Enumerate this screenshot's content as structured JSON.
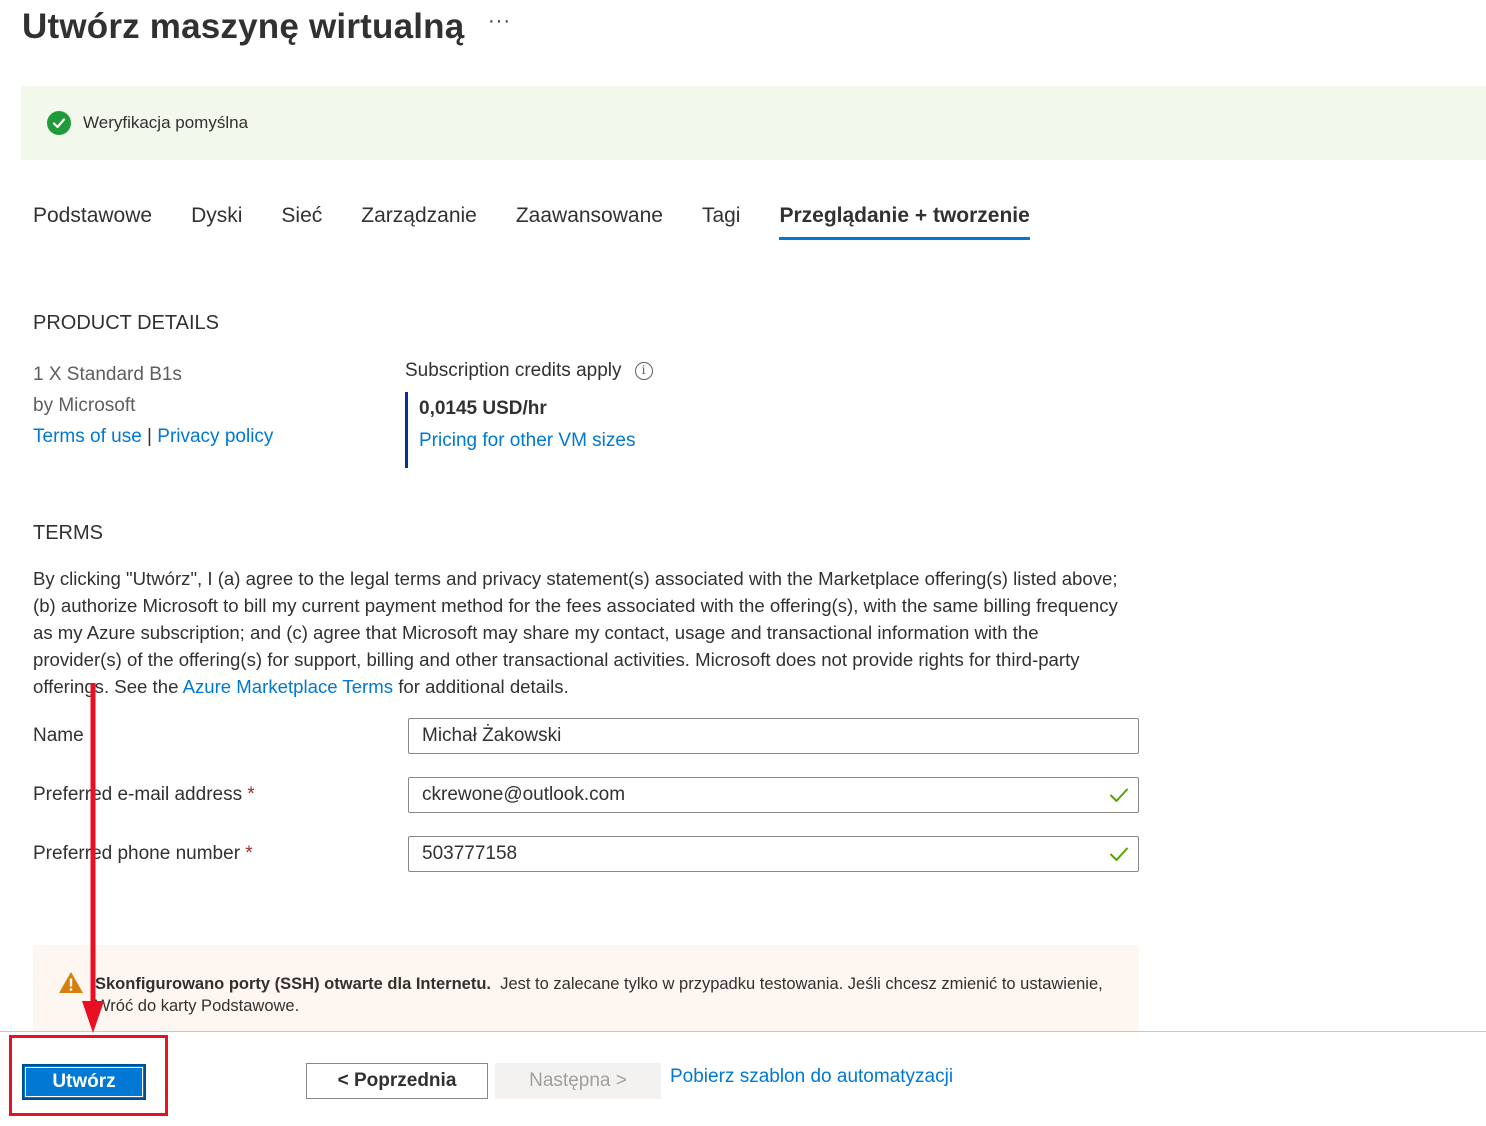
{
  "header": {
    "title": "Utwórz maszynę wirtualną",
    "more_label": "···"
  },
  "banner": {
    "message": "Weryfikacja pomyślna"
  },
  "tabs": [
    {
      "label": "Podstawowe"
    },
    {
      "label": "Dyski"
    },
    {
      "label": "Sieć"
    },
    {
      "label": "Zarządzanie"
    },
    {
      "label": "Zaawansowane"
    },
    {
      "label": "Tagi"
    },
    {
      "label": "Przeglądanie + tworzenie",
      "active": true
    }
  ],
  "product": {
    "heading": "PRODUCT DETAILS",
    "name": "1 X Standard B1s",
    "publisher": "by Microsoft",
    "terms_link": "Terms of use",
    "separator": "|",
    "privacy_link": "Privacy policy",
    "credits_label": "Subscription credits apply",
    "price": "0,0145 USD/hr",
    "pricing_link": "Pricing for other VM sizes"
  },
  "terms": {
    "heading": "TERMS",
    "text_before": "By clicking \"Utwórz\", I (a) agree to the legal terms and privacy statement(s) associated with the Marketplace offering(s) listed above; (b) authorize Microsoft to bill my current payment method for the fees associated with the offering(s), with the same billing frequency as my Azure subscription; and (c) agree that Microsoft may share my contact, usage and transactional information with the provider(s) of the offering(s) for support, billing and other transactional activities. Microsoft does not provide rights for third-party offerings. See the ",
    "link": "Azure Marketplace Terms",
    "text_after": " for additional details."
  },
  "form": {
    "name_label": "Name",
    "name_value": "Michał Żakowski",
    "email_label": "Preferred e-mail address",
    "email_value": "ckrewone@outlook.com",
    "phone_label": "Preferred phone number",
    "phone_value": "503777158",
    "required_mark": "*"
  },
  "warning": {
    "bold": "Skonfigurowano porty (SSH) otwarte dla Internetu.",
    "text": "Jest to zalecane tylko w przypadku testowania.  Jeśli chcesz zmienić to ustawienie, Wróć do karty Podstawowe."
  },
  "footer": {
    "create_label": "Utwórz",
    "previous_label": "< Poprzednia",
    "next_label": "Następna >",
    "download_link": "Pobierz szablon do automatyzacji"
  },
  "colors": {
    "accent": "#0078d4",
    "success": "#1f9c39",
    "warning": "#d67f0a",
    "annotation": "#e81123"
  }
}
